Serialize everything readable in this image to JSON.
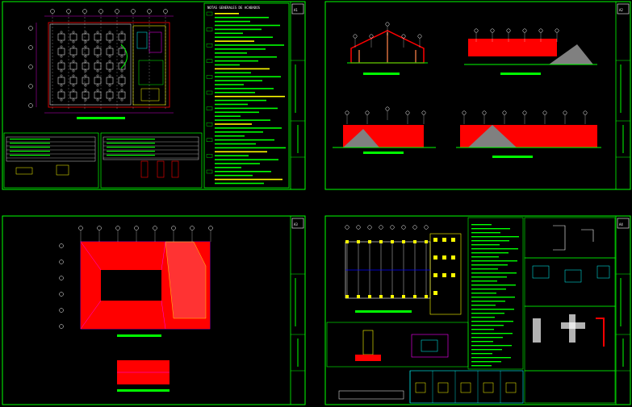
{
  "colors": {
    "background": "#000000",
    "frame": "#00ff00",
    "fill_red": "#ff0000",
    "grid_white": "#ffffff",
    "dim_magenta": "#ff00ff",
    "yellow": "#ffff00",
    "cyan": "#00ffff",
    "blue": "#0000ff",
    "gray": "#808080"
  },
  "sheets": [
    {
      "id": "sheet-1",
      "numbers": [
        "A1"
      ]
    },
    {
      "id": "sheet-2",
      "numbers": [
        "A2"
      ]
    },
    {
      "id": "sheet-3",
      "numbers": [
        "A3"
      ]
    },
    {
      "id": "sheet-4",
      "numbers": [
        "A4"
      ]
    }
  ],
  "sheet1": {
    "notes_title": "NOTAS GENERALES DE ACABADOS"
  }
}
